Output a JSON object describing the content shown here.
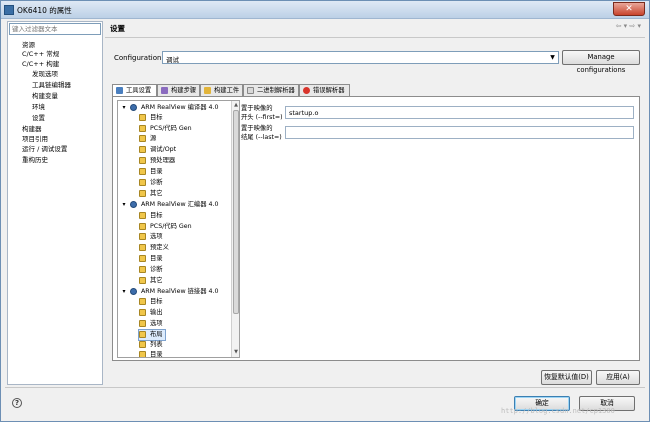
{
  "window": {
    "title": "OK6410 的属性",
    "close_label": "✕"
  },
  "filter": {
    "placeholder": "键入过滤器文本"
  },
  "nav": {
    "items": [
      "资源",
      "C/C++ 常规",
      "C/C++ 构建",
      "发现选项",
      "工具链编辑器",
      "构建变量",
      "环境",
      "设置",
      "构建器",
      "项目引用",
      "运行 / 调试设置",
      "重构历史"
    ]
  },
  "header": {
    "title": "设置",
    "nav_arrows": "⇦ ▾ ⇨ ▾"
  },
  "config": {
    "label": "Configuration:",
    "value": "调试",
    "arrow": "▼",
    "manage_label": "Manage configurations"
  },
  "tabs": [
    "工具设置",
    "构建步骤",
    "构建工件",
    "二进制解析器",
    "错误解析器"
  ],
  "tree": {
    "groups": [
      {
        "title": "ARM RealView 编译器 4.0",
        "items": [
          "目标",
          "PCS/代码 Gen",
          "源",
          "调试/Opt",
          "预处理器",
          "目录",
          "诊断",
          "其它"
        ]
      },
      {
        "title": "ARM RealView 汇编器 4.0",
        "items": [
          "目标",
          "PCS/代码 Gen",
          "选项",
          "预定义",
          "目录",
          "诊断",
          "其它"
        ]
      },
      {
        "title": "ARM RealView 链接器 4.0",
        "items": [
          "目标",
          "输出",
          "选项",
          "布局",
          "列表",
          "目录"
        ]
      }
    ]
  },
  "fields": {
    "first": {
      "label_line1": "置于映像的",
      "label_line2": "开头 (--first=)",
      "value": "startup.o"
    },
    "last": {
      "label_line1": "置于映像的",
      "label_line2": "结尾 (--last=)",
      "value": ""
    }
  },
  "buttons": {
    "restore_defaults": "恢复默认值(D)",
    "apply": "应用(A)",
    "ok": "确定",
    "cancel": "取消"
  },
  "help_icon": "?",
  "watermark": "http://blog.csdn.net/cp1300"
}
